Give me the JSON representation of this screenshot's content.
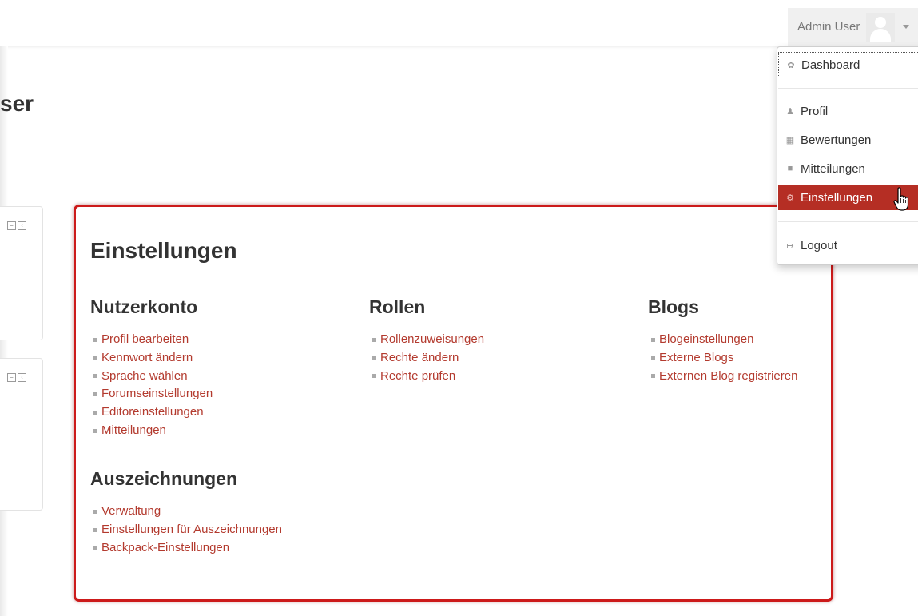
{
  "navbar": {
    "user_name": "Admin User",
    "avatar_icon": "user-avatar",
    "caret_icon": "caret-down-icon"
  },
  "page": {
    "title_partial": "ser"
  },
  "settings": {
    "title": "Einstellungen",
    "sections": [
      {
        "title": "Nutzerkonto",
        "links": [
          "Profil bearbeiten",
          "Kennwort ändern",
          "Sprache wählen",
          "Forumseinstellungen",
          "Editoreinstellungen",
          "Mitteilungen"
        ]
      },
      {
        "title": "Rollen",
        "links": [
          "Rollenzuweisungen",
          "Rechte ändern",
          "Rechte prüfen"
        ]
      },
      {
        "title": "Blogs",
        "links": [
          "Blogeinstellungen",
          "Externe Blogs",
          "Externen Blog registrieren"
        ]
      },
      {
        "title": "Auszeichnungen",
        "links": [
          "Verwaltung",
          "Einstellungen für Auszeichnungen",
          "Backpack-Einstellungen"
        ]
      }
    ]
  },
  "dropdown": {
    "items": [
      {
        "label": "Dashboard",
        "icon": "dashboard-icon"
      },
      {
        "label": "Profil",
        "icon": "user-icon"
      },
      {
        "label": "Bewertungen",
        "icon": "table-icon"
      },
      {
        "label": "Mitteilungen",
        "icon": "comment-icon"
      },
      {
        "label": "Einstellungen",
        "icon": "gear-icon",
        "active": true
      },
      {
        "label": "Logout",
        "icon": "sign-out-icon"
      }
    ]
  },
  "colors": {
    "link": "#b33a2e",
    "active_menu": "#b52e24",
    "highlight_border": "#cc1a1a"
  }
}
